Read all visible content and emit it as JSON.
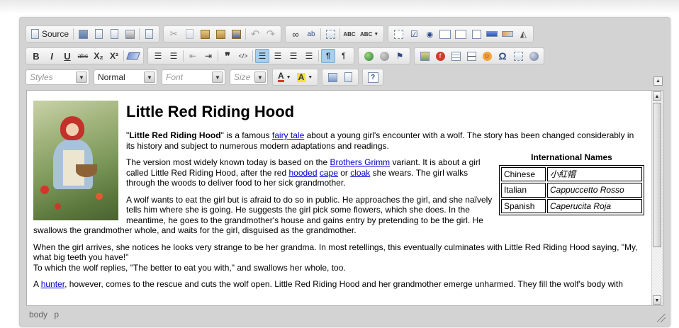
{
  "toolbar": {
    "source_label": "Source",
    "styles_placeholder": "Styles",
    "format_value": "Normal",
    "font_placeholder": "Font",
    "size_placeholder": "Size",
    "glyphs": {
      "bold": "B",
      "italic": "I",
      "underline": "U",
      "strike": "abc",
      "subscript": "X₂",
      "superscript": "X²",
      "blockquote": "❞",
      "ltr": "¶",
      "rtl": "¶",
      "omega": "Ω",
      "help": "?",
      "undo": "↶",
      "redo": "↷",
      "spell": "ABC",
      "spellcheck": "ABC",
      "find": "⌕",
      "replace": "ab",
      "textcolor": "A",
      "bgcolor": "A"
    }
  },
  "content": {
    "title": "Little Red Riding Hood",
    "p1_bold": "Little Red Riding Hood",
    "p1_a": "\"",
    "p1_b": "\" is a famous ",
    "p1_link": "fairy tale",
    "p1_c": " about a young girl's encounter with a wolf. The story has been changed considerably in its history and subject to numerous modern adaptations and readings.",
    "p2_a": "The version most widely known today is based on the ",
    "p2_link1": "Brothers Grimm",
    "p2_b": " variant. It is about a girl called Little Red Riding Hood, after the red ",
    "p2_link2": "hooded",
    "p2_c": " ",
    "p2_link3": "cape",
    "p2_d": " or ",
    "p2_link4": "cloak",
    "p2_e": " she wears. The girl walks through the woods to deliver food to her sick grandmother.",
    "p3": "A wolf wants to eat the girl but is afraid to do so in public. He approaches the girl, and she naïvely tells him where she is going. He suggests the girl pick some flowers, which she does. In the meantime, he goes to the grandmother's house and gains entry by pretending to be the girl. He swallows the grandmother whole, and waits for the girl, disguised as the grandmother.",
    "p4_l1": "When the girl arrives, she notices he looks very strange to be her grandma. In most retellings, this eventually culminates with Little Red Riding Hood saying, \"My, what big teeth you have!\"",
    "p4_l2": "To which the wolf replies, \"The better to eat you with,\" and swallows her whole, too.",
    "p5_a": "A ",
    "p5_link": "hunter",
    "p5_b": ", however, comes to the rescue and cuts the wolf open. Little Red Riding Hood and her grandmother emerge unharmed. They fill the wolf's body with"
  },
  "names_table": {
    "caption": "International Names",
    "rows": [
      {
        "lang": "Chinese",
        "name": "小紅帽"
      },
      {
        "lang": "Italian",
        "name": "Cappuccetto Rosso"
      },
      {
        "lang": "Spanish",
        "name": "Caperucita Roja"
      }
    ]
  },
  "status": {
    "path": [
      "body",
      "p"
    ]
  }
}
